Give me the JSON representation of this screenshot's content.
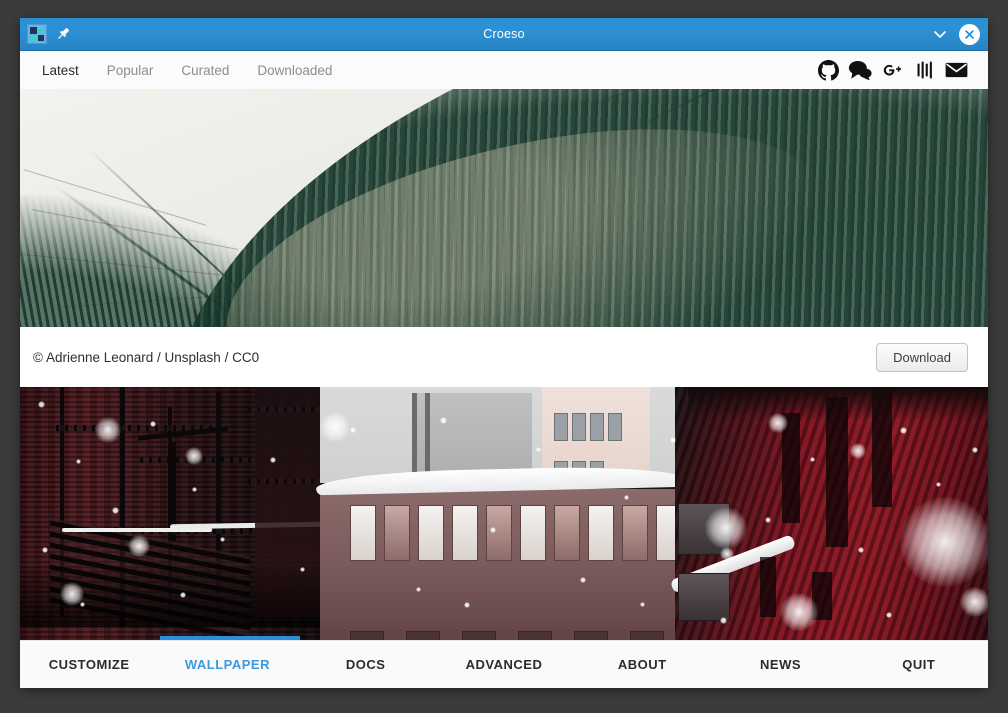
{
  "window": {
    "title": "Croeso",
    "app_icon": "app-grid-icon",
    "pin_icon": "pin-icon",
    "minimize_icon": "chevron-down-icon",
    "close_icon": "close-icon"
  },
  "topnav": {
    "tabs": [
      {
        "label": "Latest",
        "active": true
      },
      {
        "label": "Popular",
        "active": false
      },
      {
        "label": "Curated",
        "active": false
      },
      {
        "label": "Downloaded",
        "active": false
      }
    ],
    "social": [
      {
        "name": "github-icon"
      },
      {
        "name": "chat-bubbles-icon"
      },
      {
        "name": "google-plus-icon"
      },
      {
        "name": "slack-bars-icon"
      },
      {
        "name": "envelope-icon"
      }
    ]
  },
  "wallpaper_card": {
    "image_alt": "palm-fronds-photo",
    "caption": "© Adrienne Leonard / Unsplash / CC0",
    "download_label": "Download"
  },
  "wallpaper_card_2": {
    "image_alt": "snowy-street-photo"
  },
  "bottomnav": {
    "items": [
      {
        "label": "CUSTOMIZE",
        "active": false
      },
      {
        "label": "WALLPAPER",
        "active": true
      },
      {
        "label": "DOCS",
        "active": false
      },
      {
        "label": "ADVANCED",
        "active": false
      },
      {
        "label": "ABOUT",
        "active": false
      },
      {
        "label": "NEWS",
        "active": false
      },
      {
        "label": "QUIT",
        "active": false
      }
    ]
  },
  "colors": {
    "titlebar": "#2a8fd4",
    "accent": "#3a9ae0",
    "indicator": "#2b8fd8",
    "desktop": "#3b3b3b",
    "icon_navy": "#22325c",
    "icon_teal": "#3fd0c9"
  }
}
